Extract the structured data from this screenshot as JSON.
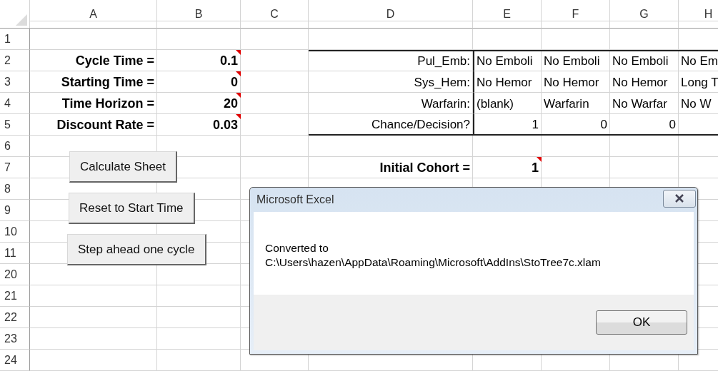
{
  "columns": [
    "A",
    "B",
    "C",
    "D",
    "E",
    "F",
    "G",
    "H"
  ],
  "rows": [
    {
      "number": "1",
      "cells": {}
    },
    {
      "number": "2",
      "framed": true,
      "cells": {
        "a": {
          "text": "Cycle Time =",
          "kind": "label",
          "bold": true
        },
        "b": {
          "text": "0.1",
          "kind": "number",
          "bold": true,
          "comment": true
        },
        "d": {
          "text": "Pul_Emb:",
          "kind": "label"
        },
        "e": {
          "text": "No Emboli",
          "kind": "text"
        },
        "f": {
          "text": "No Emboli",
          "kind": "text"
        },
        "g": {
          "text": "No Emboli",
          "kind": "text"
        },
        "h": {
          "text": "No Em",
          "kind": "text"
        }
      }
    },
    {
      "number": "3",
      "framed": true,
      "cells": {
        "a": {
          "text": "Starting Time =",
          "kind": "label",
          "bold": true
        },
        "b": {
          "text": "0",
          "kind": "number",
          "bold": true,
          "comment": true
        },
        "d": {
          "text": "Sys_Hem:",
          "kind": "label"
        },
        "e": {
          "text": "No Hemor",
          "kind": "text"
        },
        "f": {
          "text": "No Hemor",
          "kind": "text"
        },
        "g": {
          "text": "No Hemor",
          "kind": "text"
        },
        "h": {
          "text": "Long T",
          "kind": "text"
        }
      }
    },
    {
      "number": "4",
      "framed": true,
      "cells": {
        "a": {
          "text": "Time Horizon =",
          "kind": "label",
          "bold": true
        },
        "b": {
          "text": "20",
          "kind": "number",
          "bold": true,
          "comment": true
        },
        "d": {
          "text": "Warfarin:",
          "kind": "label"
        },
        "e": {
          "text": "(blank)",
          "kind": "text"
        },
        "f": {
          "text": "Warfarin",
          "kind": "text"
        },
        "g": {
          "text": "No Warfar",
          "kind": "text"
        },
        "h": {
          "text": "No W",
          "kind": "text"
        }
      }
    },
    {
      "number": "5",
      "framed": true,
      "cells": {
        "a": {
          "text": "Discount Rate =",
          "kind": "label",
          "bold": true
        },
        "b": {
          "text": "0.03",
          "kind": "number",
          "bold": true,
          "comment": true
        },
        "d": {
          "text": "Chance/Decision?",
          "kind": "label"
        },
        "e": {
          "text": "1",
          "kind": "number"
        },
        "f": {
          "text": "0",
          "kind": "number"
        },
        "g": {
          "text": "0",
          "kind": "number"
        }
      }
    },
    {
      "number": "6",
      "cells": {}
    },
    {
      "number": "7",
      "cells": {
        "d": {
          "text": "Initial Cohort =",
          "kind": "label",
          "bold": true
        },
        "e": {
          "text": "1",
          "kind": "number",
          "bold": true,
          "comment": true
        }
      }
    },
    {
      "number": "8",
      "cells": {}
    },
    {
      "number": "9",
      "cells": {}
    },
    {
      "number": "10",
      "cells": {}
    },
    {
      "number": "11",
      "cells": {}
    },
    {
      "number": "20",
      "cells": {}
    },
    {
      "number": "21",
      "cells": {}
    },
    {
      "number": "22",
      "cells": {}
    },
    {
      "number": "23",
      "cells": {}
    },
    {
      "number": "24",
      "cells": {}
    }
  ],
  "buttons": [
    "Calculate Sheet",
    "Reset to Start Time",
    "Step ahead one cycle"
  ],
  "dialog": {
    "title": "Microsoft Excel",
    "message": [
      "Converted to",
      "C:\\Users\\hazen\\AppData\\Roaming\\Microsoft\\AddIns\\StoTree7c.xlam"
    ],
    "button": "OK"
  }
}
